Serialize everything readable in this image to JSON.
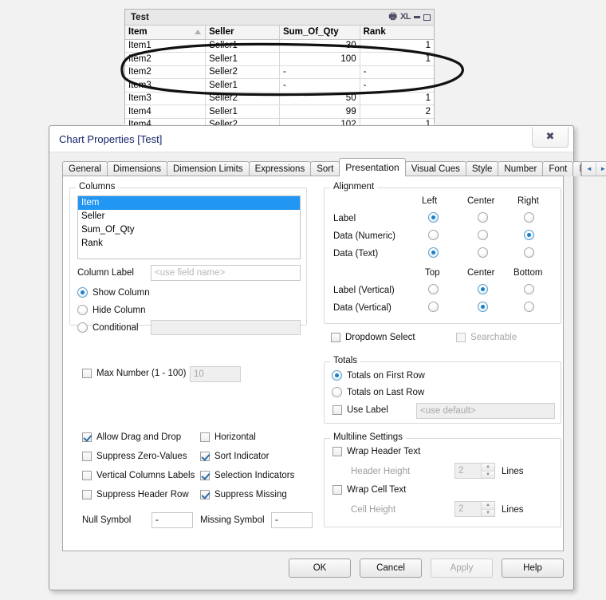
{
  "table_window": {
    "caption": "Test",
    "icons": [
      "print-icon",
      "excel-export-icon",
      "minimize-icon",
      "maximize-icon"
    ],
    "excel_label": "XL",
    "columns": [
      "Item",
      "Seller",
      "Sum_Of_Qty",
      "Rank"
    ],
    "sorted_column": "Item",
    "rows": [
      {
        "item": "Item1",
        "seller": "Seller1",
        "qty": "30",
        "rank": "1"
      },
      {
        "item": "Item2",
        "seller": "Seller1",
        "qty": "100",
        "rank": "1"
      },
      {
        "item": "Item2",
        "seller": "Seller2",
        "qty": "-",
        "rank": "-"
      },
      {
        "item": "Item3",
        "seller": "Seller1",
        "qty": "-",
        "rank": "-"
      },
      {
        "item": "Item3",
        "seller": "Seller2",
        "qty": "50",
        "rank": "1"
      },
      {
        "item": "Item4",
        "seller": "Seller1",
        "qty": "99",
        "rank": "2"
      },
      {
        "item": "Item4",
        "seller": "Seller2",
        "qty": "102",
        "rank": "1"
      }
    ]
  },
  "dialog": {
    "title": "Chart Properties [Test]",
    "close_glyph": "✖",
    "tabs": [
      {
        "label": "General",
        "active": false
      },
      {
        "label": "Dimensions",
        "active": false
      },
      {
        "label": "Dimension Limits",
        "active": false
      },
      {
        "label": "Expressions",
        "active": false
      },
      {
        "label": "Sort",
        "active": false
      },
      {
        "label": "Presentation",
        "active": true
      },
      {
        "label": "Visual Cues",
        "active": false
      },
      {
        "label": "Style",
        "active": false
      },
      {
        "label": "Number",
        "active": false
      },
      {
        "label": "Font",
        "active": false
      },
      {
        "label": "La",
        "active": false
      }
    ],
    "tab_scroll": {
      "left": "◄",
      "right": "►"
    },
    "columns_group": {
      "label": "Columns",
      "items": [
        "Item",
        "Seller",
        "Sum_Of_Qty",
        "Rank"
      ],
      "selected": "Item",
      "column_label_caption": "Column Label",
      "column_label_placeholder": "<use field name>",
      "column_label_value": "",
      "visibility": {
        "options": [
          "Show Column",
          "Hide Column",
          "Conditional"
        ],
        "selected": "Show Column",
        "conditional_value": ""
      }
    },
    "alignment_group": {
      "label": "Alignment",
      "horizontal_headers": [
        "Left",
        "Center",
        "Right"
      ],
      "vertical_headers": [
        "Top",
        "Center",
        "Bottom"
      ],
      "rows_horizontal": [
        {
          "label": "Label",
          "selected": "Left"
        },
        {
          "label": "Data (Numeric)",
          "selected": "Right"
        },
        {
          "label": "Data (Text)",
          "selected": "Left"
        }
      ],
      "rows_vertical": [
        {
          "label": "Label (Vertical)",
          "selected": "Center"
        },
        {
          "label": "Data (Vertical)",
          "selected": "Center"
        }
      ]
    },
    "dropdown_select": {
      "label": "Dropdown Select",
      "checked": false,
      "disabled": false
    },
    "searchable": {
      "label": "Searchable",
      "checked": false,
      "disabled": true
    },
    "max_number": {
      "label": "Max Number (1 - 100)",
      "checked": false,
      "value": "10",
      "disabled": true
    },
    "left_checkboxes": [
      {
        "label": "Allow Drag and Drop",
        "checked": true
      },
      {
        "label": "Suppress Zero-Values",
        "checked": false
      },
      {
        "label": "Vertical Columns Labels",
        "checked": false
      },
      {
        "label": "Suppress Header Row",
        "checked": false
      }
    ],
    "right_checkboxes": [
      {
        "label": "Horizontal",
        "checked": false
      },
      {
        "label": "Sort Indicator",
        "checked": true
      },
      {
        "label": "Selection Indicators",
        "checked": true
      },
      {
        "label": "Suppress Missing",
        "checked": true
      }
    ],
    "symbols": {
      "null_label": "Null Symbol",
      "null_value": "-",
      "missing_label": "Missing Symbol",
      "missing_value": "-"
    },
    "totals_group": {
      "label": "Totals",
      "options": [
        "Totals on First Row",
        "Totals on Last Row"
      ],
      "selected": "Totals on First Row",
      "use_label": {
        "label": "Use Label",
        "checked": false
      },
      "use_label_placeholder": "<use default>",
      "use_label_value": ""
    },
    "multiline_group": {
      "label": "Multiline Settings",
      "wrap_header": {
        "label": "Wrap Header Text",
        "checked": false
      },
      "header_height": {
        "label": "Header Height",
        "value": "2",
        "unit": "Lines"
      },
      "wrap_cell": {
        "label": "Wrap Cell Text",
        "checked": false
      },
      "cell_height": {
        "label": "Cell Height",
        "value": "2",
        "unit": "Lines"
      }
    },
    "footer_buttons": [
      {
        "label": "OK",
        "disabled": false
      },
      {
        "label": "Cancel",
        "disabled": false
      },
      {
        "label": "Apply",
        "disabled": true
      },
      {
        "label": "Help",
        "disabled": false
      }
    ]
  },
  "annotations": {
    "ink_color": "#111111",
    "marks": [
      "ellipse-around-table-rows",
      "ellipse-around-suppress-zero-values"
    ]
  }
}
